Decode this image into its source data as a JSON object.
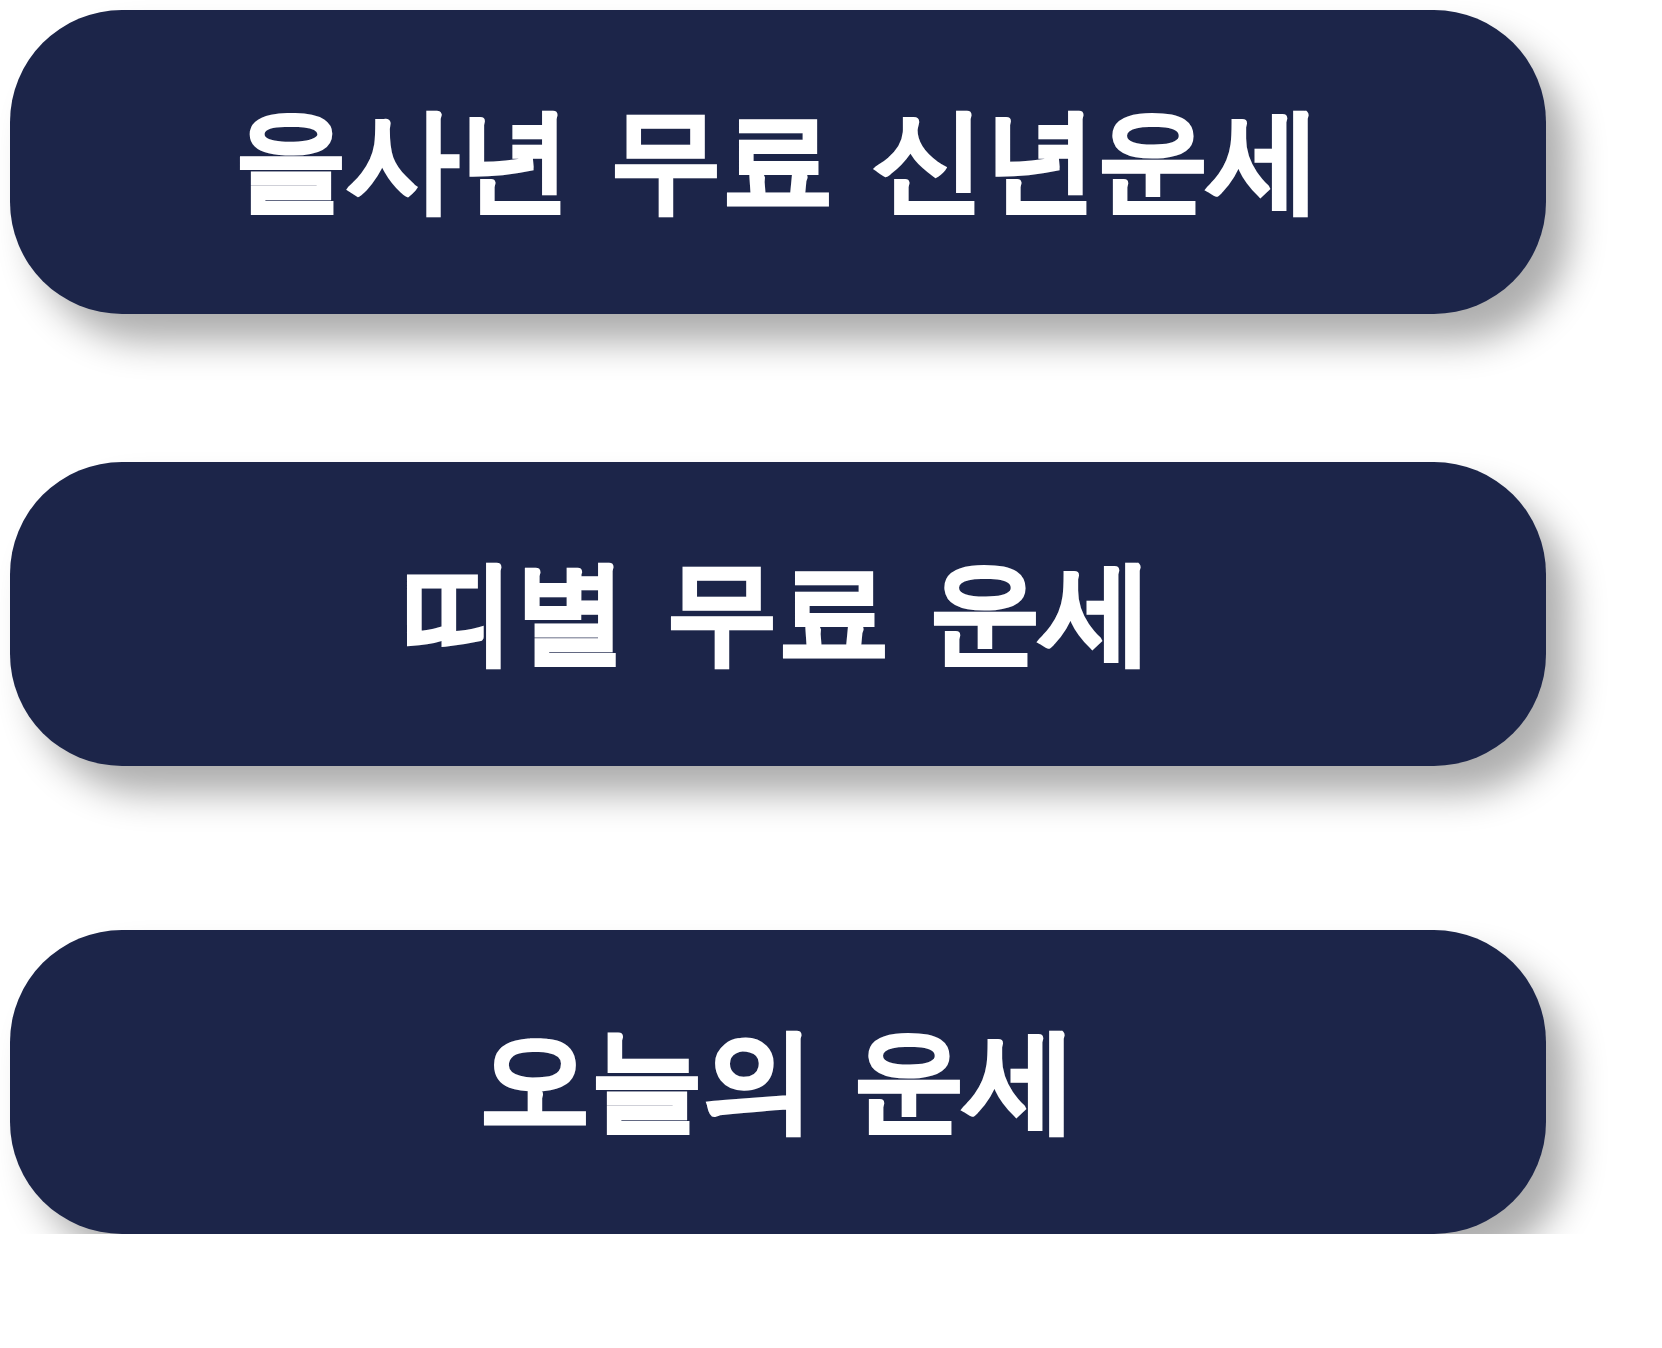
{
  "buttons": [
    {
      "label": "을사년 무료 신년운세"
    },
    {
      "label": "띠별 무료 운세"
    },
    {
      "label": "오늘의 운세"
    }
  ]
}
